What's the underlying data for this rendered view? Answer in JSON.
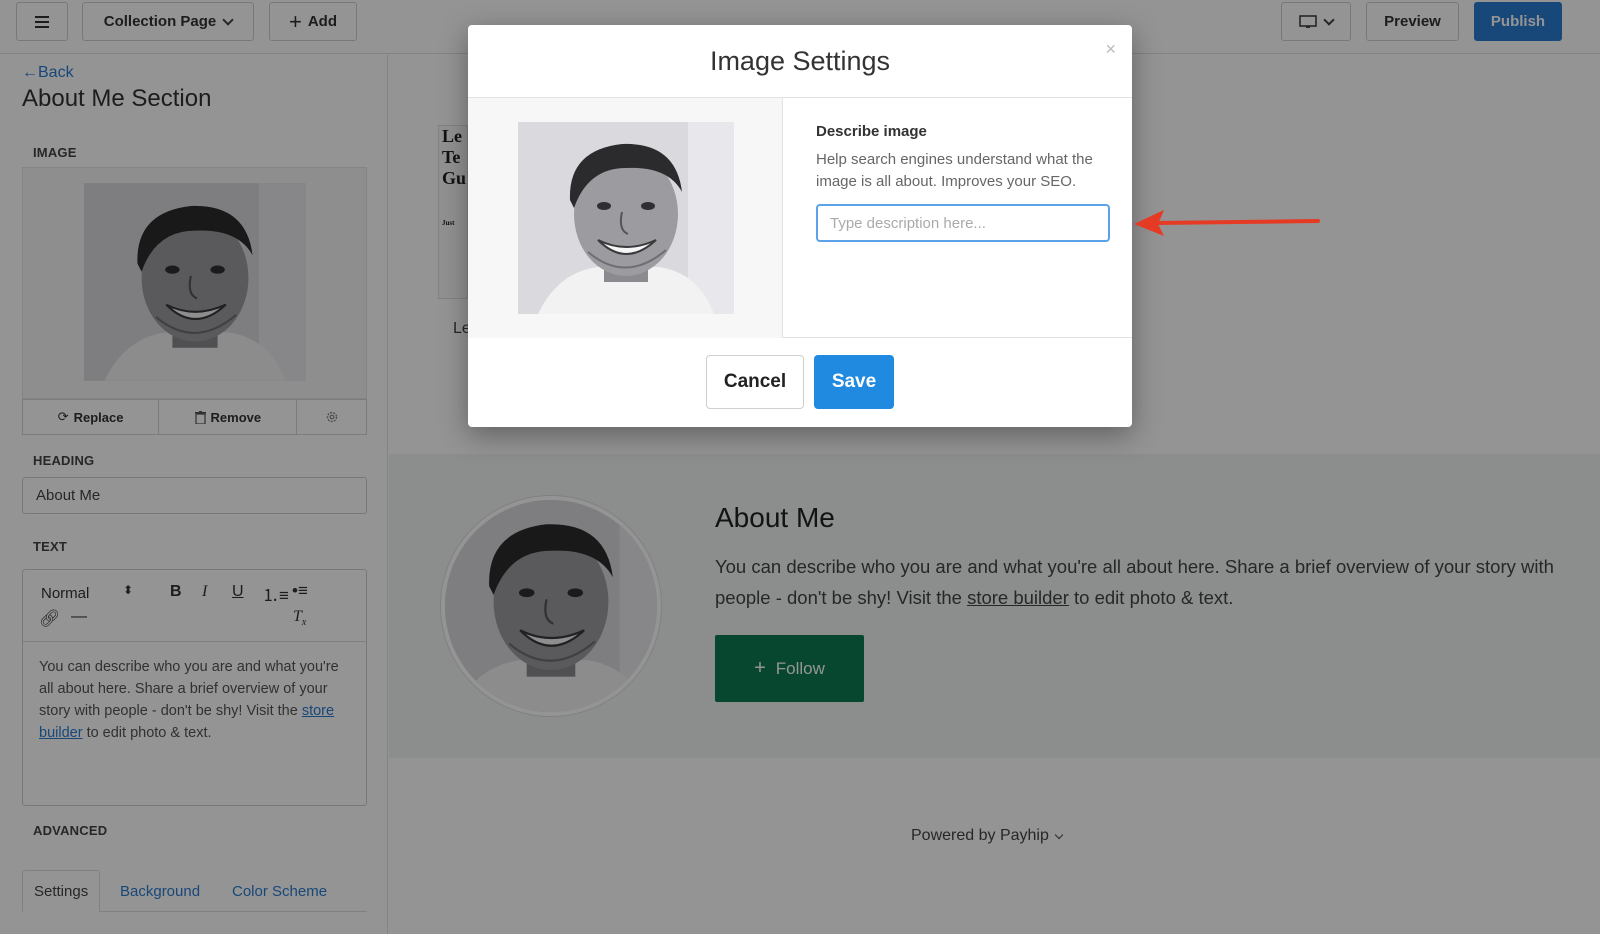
{
  "topbar": {
    "page_selector": "Collection Page",
    "add_label": "Add",
    "preview_label": "Preview",
    "publish_label": "Publish",
    "publish_color": "#2a7bd1"
  },
  "sidebar": {
    "back_label": "Back",
    "section_title": "About Me Section",
    "image_label": "IMAGE",
    "replace_label": "Replace",
    "remove_label": "Remove",
    "heading_label": "HEADING",
    "heading_value": "About Me",
    "text_label": "TEXT",
    "text_style": "Normal",
    "body_before_link": "You can describe who you are and what you're all about here. Share a brief overview of your story with people - don't be shy! Visit the",
    "body_link": "store builder",
    "body_after_link": "to edit photo & text.",
    "advanced_label": "ADVANCED",
    "tabs": [
      "Settings",
      "Background",
      "Color Scheme"
    ]
  },
  "preview": {
    "thumb_text": "Le\nTe\nGu",
    "thumb_small": "Just",
    "partial_text": "Le",
    "about_heading": "About Me",
    "about_before_link": "You can describe who you are and what you're all about here. Share a brief overview of your story with people - don't be shy! Visit the",
    "about_link": "store builder",
    "about_after_link": "to edit photo & text.",
    "follow_label": "Follow",
    "follow_color": "#0e7a52",
    "powered_by": "Powered by Payhip"
  },
  "modal": {
    "title": "Image Settings",
    "close_symbol": "×",
    "describe_label": "Describe image",
    "help_text": "Help search engines understand what the image is all about. Improves your SEO.",
    "input_placeholder": "Type description here...",
    "cancel_label": "Cancel",
    "save_label": "Save",
    "save_color": "#1f8ae0"
  },
  "annotation": {
    "arrow_color": "#e53a24"
  },
  "icons": [
    "menu-icon",
    "chevron-down-icon",
    "plus-icon",
    "monitor-icon",
    "back-arrow-icon",
    "replace-icon",
    "trash-icon",
    "gear-icon",
    "bold-icon",
    "italic-icon",
    "underline-icon",
    "ordered-list-icon",
    "bullet-list-icon",
    "link-icon",
    "horizontal-rule-icon",
    "clear-format-icon",
    "close-icon"
  ]
}
